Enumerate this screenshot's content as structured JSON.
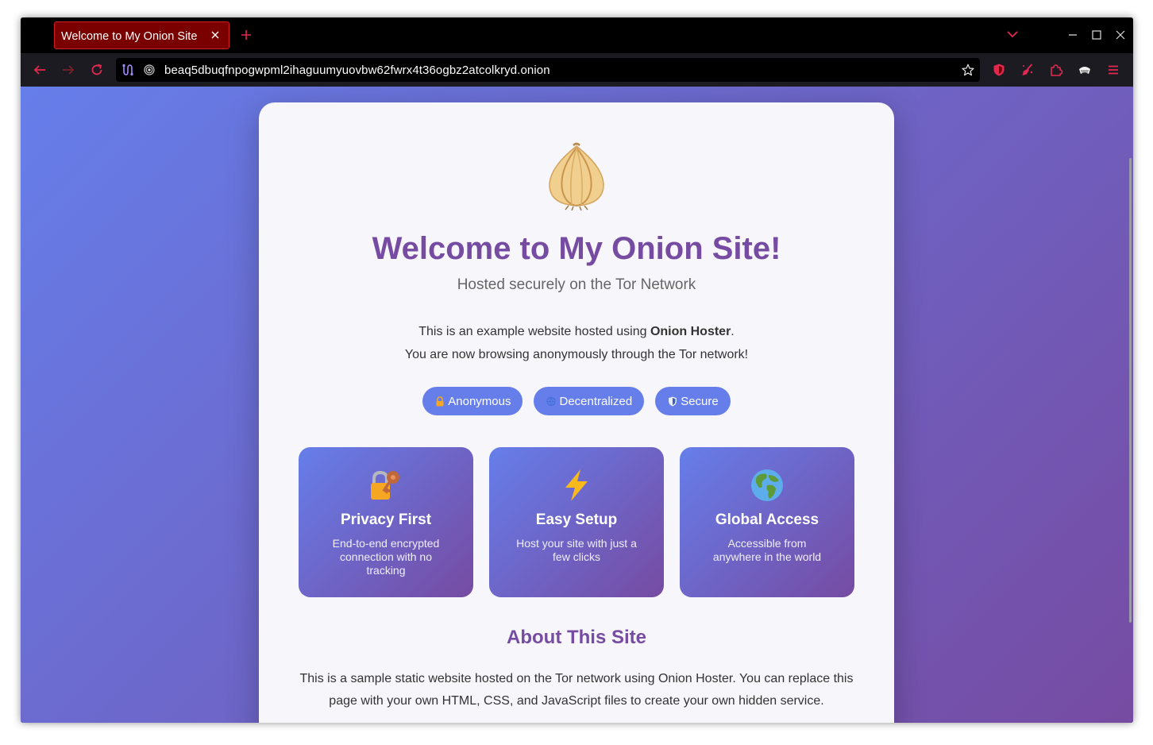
{
  "browser": {
    "tab_title": "Welcome to My Onion Site",
    "url": "beaq5dbuqfnpogwpml2ihaguumyuovbw62fwrx4t36ogbz2atcolkryd.onion",
    "accent_color": "#e22850",
    "tab_color": "#7a0000"
  },
  "icons": {
    "tab_close": "close-icon",
    "new_tab": "plus-icon",
    "tabs_menu": "chevron-down-icon",
    "back": "arrow-left-icon",
    "forward": "arrow-right-icon",
    "reload": "reload-icon",
    "circuit": "tor-circuit-icon",
    "onion_lock": "onion-icon",
    "bookmark": "star-icon",
    "shield": "shield-icon",
    "new_identity": "broom-icon",
    "extensions": "puzzle-icon",
    "security_level": "shield-level-icon",
    "menu": "hamburger-icon"
  },
  "page": {
    "title": "Welcome to My Onion Site!",
    "subtitle": "Hosted securely on the Tor Network",
    "intro_prefix": "This is an example website hosted using ",
    "intro_bold": "Onion Hoster",
    "intro_suffix": ".",
    "intro_line2": "You are now browsing anonymously through the Tor network!",
    "badges": [
      {
        "label": "Anonymous",
        "icon": "lock-icon"
      },
      {
        "label": "Decentralized",
        "icon": "globe-icon"
      },
      {
        "label": "Secure",
        "icon": "shield-icon"
      }
    ],
    "features": [
      {
        "icon": "lock-key-icon",
        "title": "Privacy First",
        "desc": "End-to-end encrypted connection with no tracking"
      },
      {
        "icon": "lightning-icon",
        "title": "Easy Setup",
        "desc": "Host your site with just a few clicks"
      },
      {
        "icon": "earth-icon",
        "title": "Global Access",
        "desc": "Accessible from anywhere in the world"
      }
    ],
    "about_title": "About This Site",
    "about_text": "This is a sample static website hosted on the Tor network using Onion Hoster. You can replace this page with your own HTML, CSS, and JavaScript files to create your own hidden service.",
    "colors": {
      "gradient_start": "#667eea",
      "gradient_end": "#764ba2",
      "title": "#764ba2"
    }
  }
}
